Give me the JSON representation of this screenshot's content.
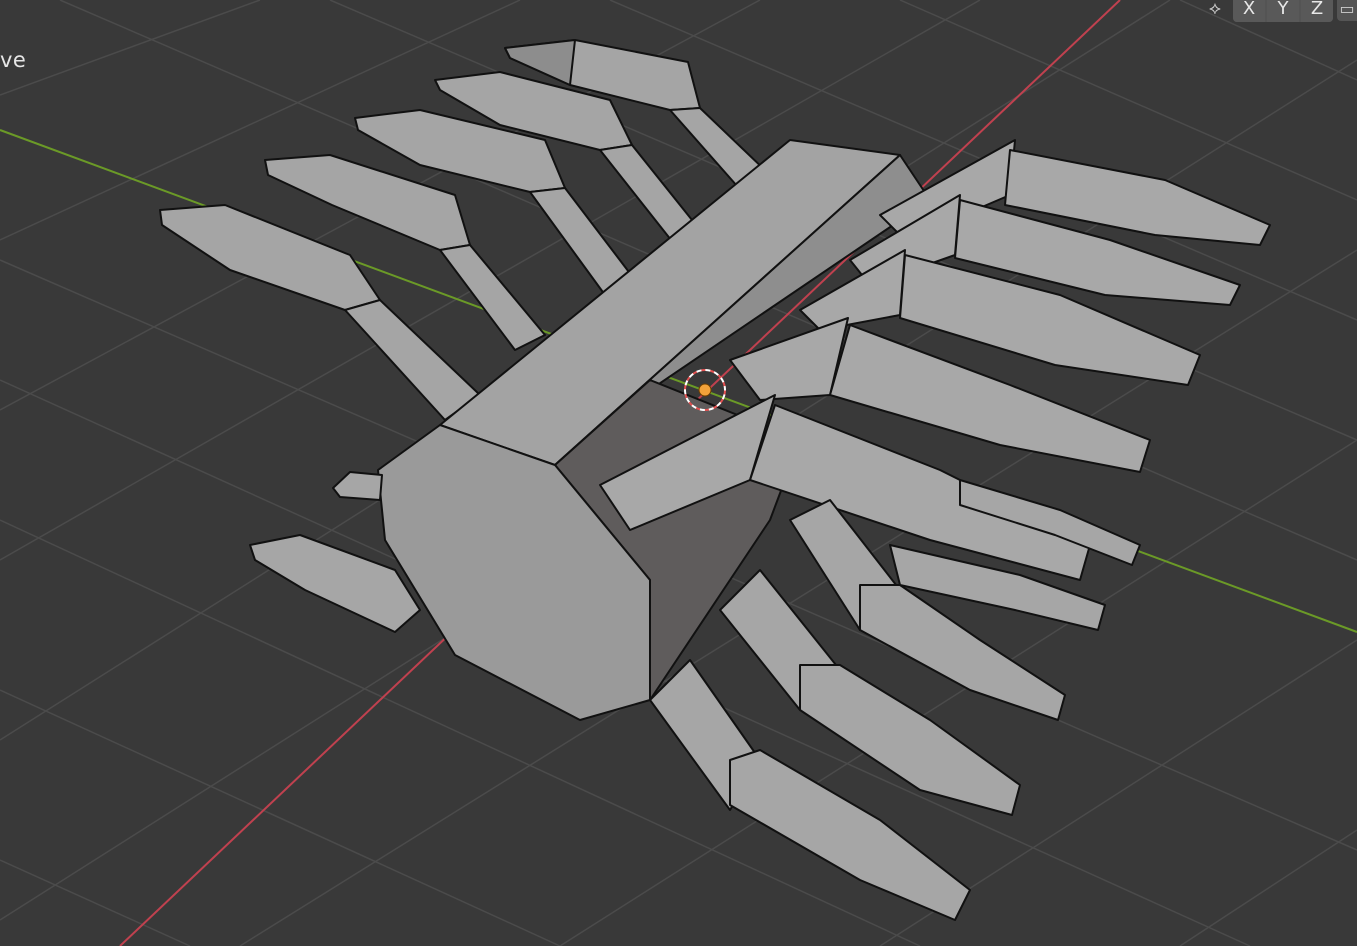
{
  "viewport": {
    "mode_label": "ve",
    "axis_buttons": [
      "X",
      "Y",
      "Z"
    ],
    "icons": {
      "transform_toggle": "move-gizmo-icon",
      "lock": "lock-icon"
    },
    "colors": {
      "background": "#393939",
      "grid_line": "#4a4a4a",
      "x_axis": "#c0414f",
      "y_axis": "#6b9a27",
      "mesh_face": "#a6a6a6",
      "mesh_face_dark": "#6a6868",
      "mesh_edge": "#111111",
      "origin": "#f2a23a"
    }
  }
}
